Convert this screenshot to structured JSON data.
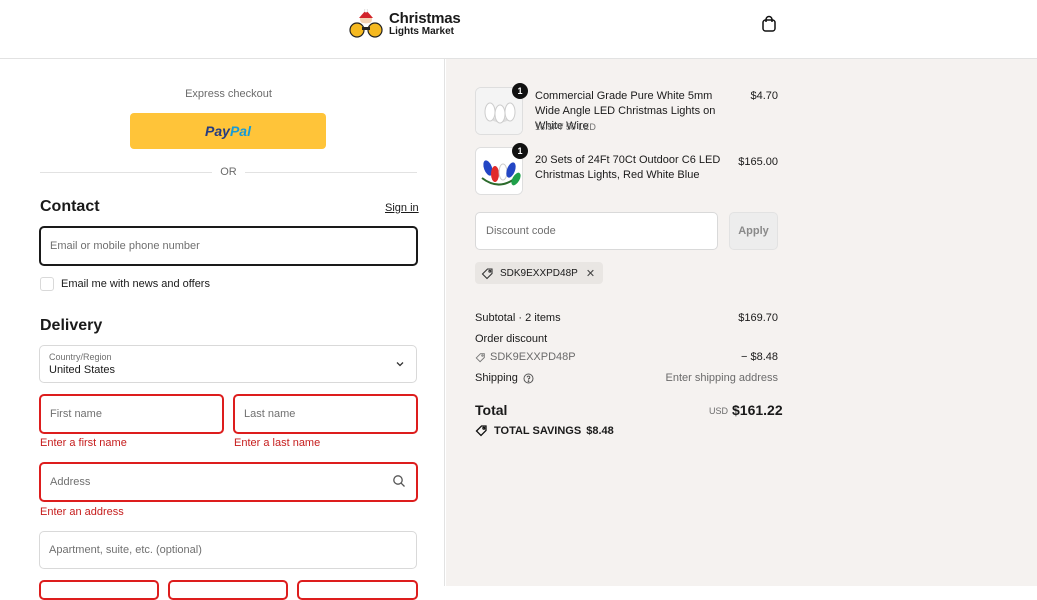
{
  "header": {
    "logo_line1": "Christmas",
    "logo_line2": "Lights Market",
    "cart_icon": "shopping-bag-icon"
  },
  "express": {
    "label": "Express checkout",
    "paypal_part1": "Pay",
    "paypal_part2": "Pal",
    "or": "OR"
  },
  "contact": {
    "title": "Contact",
    "sign_in": "Sign in",
    "email_placeholder": "Email or mobile phone number",
    "newsletter_label": "Email me with news and offers"
  },
  "delivery": {
    "title": "Delivery",
    "country_label": "Country/Region",
    "country_value": "United States",
    "first_name_placeholder": "First name",
    "first_name_error": "Enter a first name",
    "last_name_placeholder": "Last name",
    "last_name_error": "Enter a last name",
    "address_placeholder": "Address",
    "address_error": "Enter an address",
    "apartment_placeholder": "Apartment, suite, etc. (optional)"
  },
  "cart": {
    "items": [
      {
        "quantity": "1",
        "name": "Commercial Grade Pure White 5mm Wide Angle LED Christmas Lights on White Wire",
        "variant": "16.5FT 50 LED",
        "price": "$4.70"
      },
      {
        "quantity": "1",
        "name": "20 Sets of 24Ft 70Ct Outdoor C6 LED Christmas Lights, Red White Blue",
        "variant": "",
        "price": "$165.00"
      }
    ],
    "discount_placeholder": "Discount code",
    "apply_label": "Apply",
    "applied_code": "SDK9EXXPD48P"
  },
  "summary": {
    "subtotal_label": "Subtotal · 2 items",
    "subtotal_value": "$169.70",
    "order_discount_label": "Order discount",
    "discount_code": "SDK9EXXPD48P",
    "discount_value": "− $8.48",
    "shipping_label": "Shipping",
    "shipping_value": "Enter shipping address",
    "total_label": "Total",
    "currency": "USD",
    "total_value": "$161.22",
    "savings_label": "TOTAL SAVINGS",
    "savings_value": "$8.48"
  },
  "colors": {
    "paypal_yellow": "#ffc439",
    "error_red": "#dd1d1d",
    "summary_bg": "#f5f2f0"
  }
}
